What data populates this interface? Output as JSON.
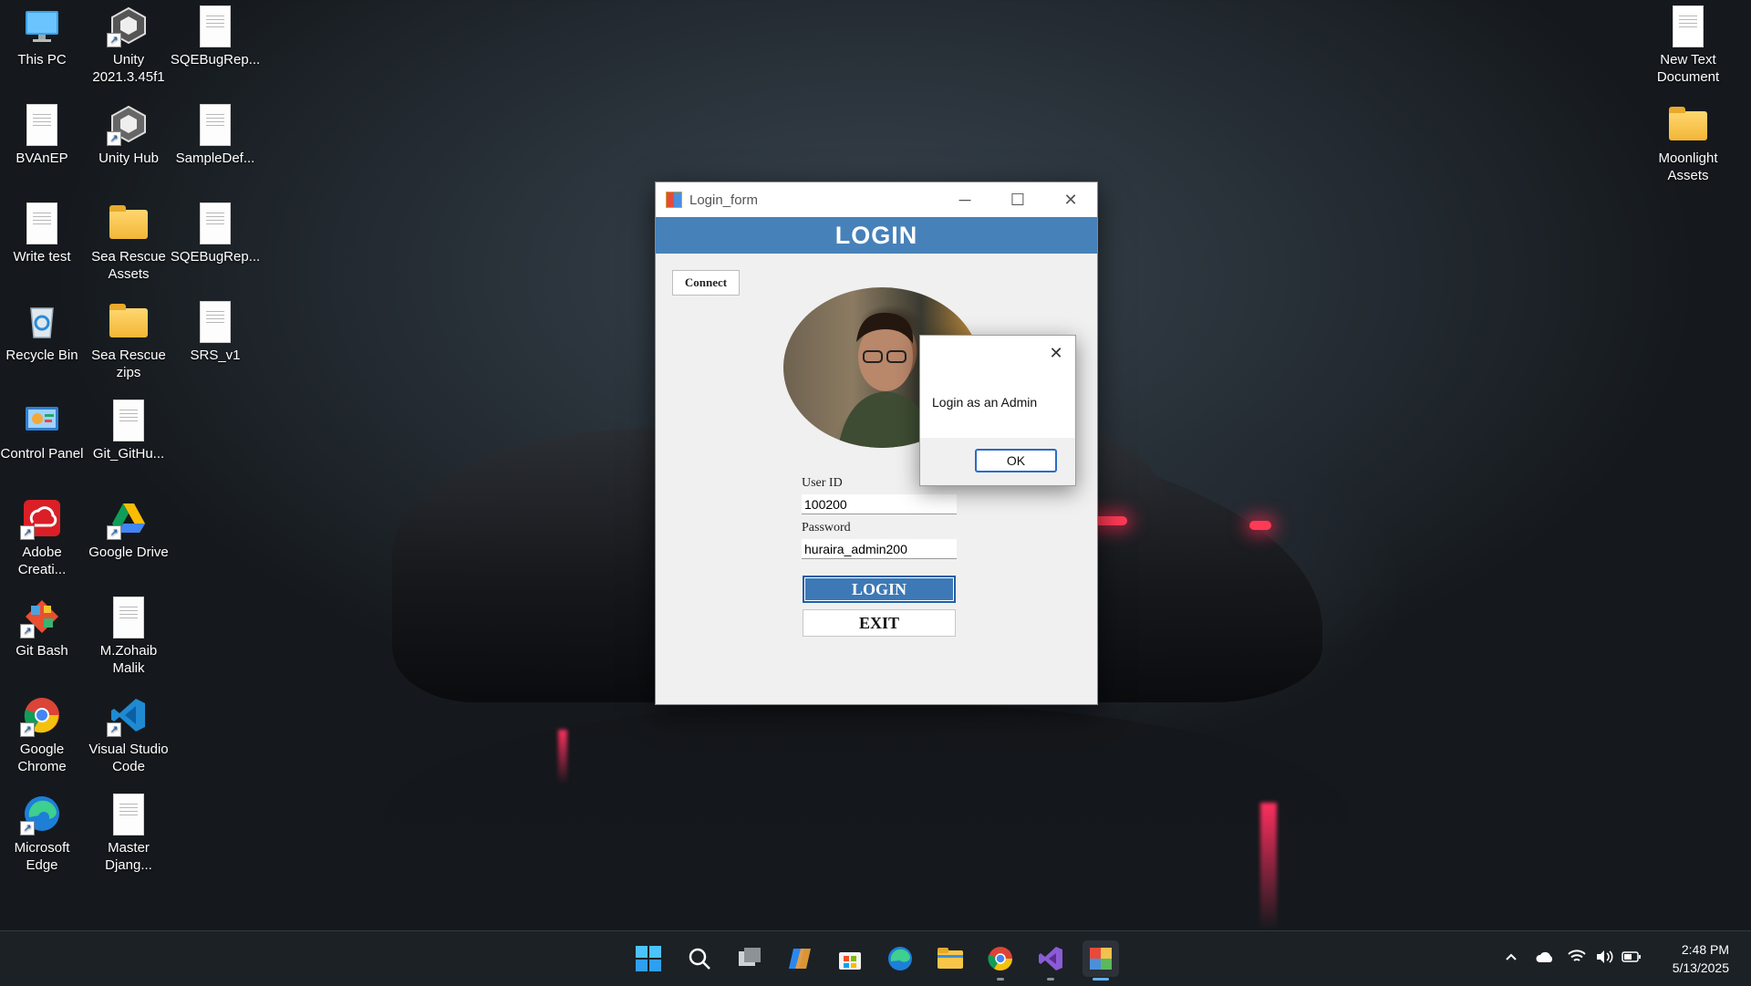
{
  "desktop": {
    "icons": [
      {
        "label": "This PC",
        "icon": "monitor-icon"
      },
      {
        "label": "Unity 2021.3.45f1",
        "icon": "unity-icon"
      },
      {
        "label": "SQEBugRep...",
        "icon": "document-icon"
      },
      {
        "label": "BVAnEP",
        "icon": "document-icon"
      },
      {
        "label": "Unity Hub",
        "icon": "unity-icon"
      },
      {
        "label": "SampleDef...",
        "icon": "document-icon"
      },
      {
        "label": "Write test",
        "icon": "document-icon"
      },
      {
        "label": "Sea Rescue Assets",
        "icon": "folder-icon"
      },
      {
        "label": "SQEBugRep...",
        "icon": "document-icon"
      },
      {
        "label": "Recycle Bin",
        "icon": "recycle-bin-icon"
      },
      {
        "label": "Sea Rescue zips",
        "icon": "folder-icon"
      },
      {
        "label": "SRS_v1",
        "icon": "document-icon"
      },
      {
        "label": "Control Panel",
        "icon": "control-panel-icon"
      },
      {
        "label": "Git_GitHu...",
        "icon": "document-icon"
      },
      {
        "label": "Adobe Creati...",
        "icon": "adobe-cc-icon"
      },
      {
        "label": "Google Drive",
        "icon": "google-drive-icon"
      },
      {
        "label": "Git Bash",
        "icon": "git-icon"
      },
      {
        "label": "M.Zohaib Malik",
        "icon": "document-icon"
      },
      {
        "label": "Google Chrome",
        "icon": "chrome-icon"
      },
      {
        "label": "Visual Studio Code",
        "icon": "vscode-icon"
      },
      {
        "label": "Microsoft Edge",
        "icon": "edge-icon"
      },
      {
        "label": "Master Djang...",
        "icon": "document-icon"
      },
      {
        "label": "New Text Document",
        "icon": "text-document-icon"
      },
      {
        "label": "Moonlight Assets",
        "icon": "folder-icon"
      }
    ]
  },
  "window": {
    "title": "Login_form",
    "banner": "LOGIN",
    "connect_label": "Connect",
    "user_id_label": "User ID",
    "user_id_value": "100200",
    "password_label": "Password",
    "password_value": "huraira_admin200",
    "login_label": "LOGIN",
    "exit_label": "EXIT",
    "minimize_glyph": "─",
    "maximize_glyph": "☐",
    "close_glyph": "✕"
  },
  "dialog": {
    "message": "Login as an Admin",
    "ok_label": "OK",
    "close_glyph": "✕"
  },
  "taskbar": {
    "apps": [
      "start-icon",
      "search-icon",
      "task-view-icon",
      "copilot-icon",
      "store-icon",
      "edge-icon",
      "file-explorer-icon",
      "chrome-icon",
      "visual-studio-icon",
      "login-form-app-icon"
    ],
    "time": "2:48 PM",
    "date": "5/13/2025"
  },
  "colors": {
    "banner": "#4781b9",
    "login_button": "#3d79b6",
    "ok_border": "#2a6cc7"
  }
}
